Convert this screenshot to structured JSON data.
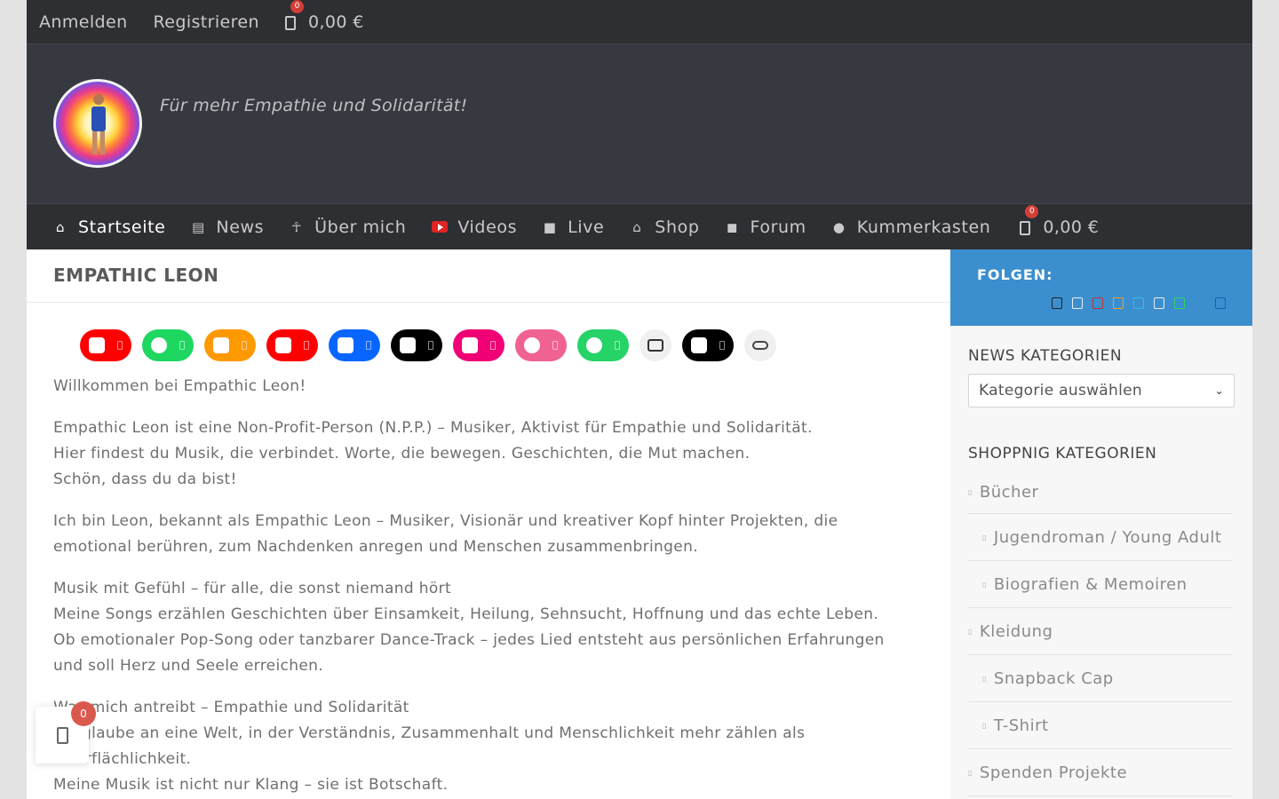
{
  "topbar": {
    "login": "Anmelden",
    "register": "Registrieren",
    "cart_count": "0",
    "cart_total": "0,00 €"
  },
  "header": {
    "tagline": "Für mehr Empathie und Solidarität!"
  },
  "nav": {
    "items": [
      {
        "label": "Startseite",
        "icon": "home-icon",
        "active": true
      },
      {
        "label": "News",
        "icon": "newspaper-icon"
      },
      {
        "label": "Über mich",
        "icon": "person-icon"
      },
      {
        "label": "Videos",
        "icon": "youtube-icon"
      },
      {
        "label": "Live",
        "icon": "video-camera-icon"
      },
      {
        "label": "Shop",
        "icon": "store-icon"
      },
      {
        "label": "Forum",
        "icon": "comments-icon"
      },
      {
        "label": "Kummerkasten",
        "icon": "speech-bubble-icon"
      }
    ],
    "cart_count": "0",
    "cart_total": "0,00 €"
  },
  "main": {
    "title": "EMPATHIC LEON",
    "social": [
      {
        "name": "youtube",
        "color": "#ff0000"
      },
      {
        "name": "spotify",
        "color": "#1ed760"
      },
      {
        "name": "amazon",
        "color": "#f90"
      },
      {
        "name": "youtube",
        "color": "#ff0000"
      },
      {
        "name": "facebook",
        "color": "#0866ff"
      },
      {
        "name": "tiktok",
        "color": "#000000"
      },
      {
        "name": "instagram",
        "color": "#f00075"
      },
      {
        "name": "dribbble",
        "color": "#f06292"
      },
      {
        "name": "whatsapp",
        "color": "#25d366"
      },
      {
        "name": "mail",
        "color": "#f0f0f0"
      },
      {
        "name": "threads",
        "color": "#000000"
      },
      {
        "name": "link",
        "color": "#f0f0f0"
      }
    ],
    "intro": "Willkommen bei Empathic Leon!",
    "p1": [
      "Empathic Leon ist eine Non-Profit-Person (N.P.P.) – Musiker, Aktivist für Empathie und Solidarität.",
      "Hier findest du Musik, die verbindet. Worte, die bewegen. Geschichten, die Mut machen.",
      "Schön, dass du da bist!"
    ],
    "p2": [
      "Ich bin Leon, bekannt als Empathic Leon – Musiker, Visionär und kreativer Kopf hinter Projekten, die",
      "emotional berühren, zum Nachdenken anregen und Menschen zusammenbringen."
    ],
    "p3": [
      "Musik mit Gefühl – für alle, die sonst niemand hört",
      "Meine Songs erzählen Geschichten über Einsamkeit, Heilung, Sehnsucht, Hoffnung und das echte Leben.",
      "Ob emotionaler Pop-Song oder tanzbarer Dance-Track – jedes Lied entsteht aus persönlichen Erfahrungen",
      "und soll Herz und Seele erreichen."
    ],
    "p4": [
      "Was mich antreibt – Empathie und Solidarität",
      "Ich glaube an eine Welt, in der Verständnis, Zusammenhalt und Menschlichkeit mehr zählen als",
      "Oberflächlichkeit.",
      "Meine Musik ist nicht nur Klang – sie ist Botschaft."
    ],
    "glyph": ""
  },
  "sidebar": {
    "follow_title": "FOLGEN:",
    "follow_icons": [
      {
        "icon": "x-icon",
        "color": "#222222"
      },
      {
        "icon": "facebook-icon",
        "color": "#eeeeee"
      },
      {
        "icon": "youtube-icon",
        "color": "#c4302b"
      },
      {
        "icon": "amazon-icon",
        "color": "#f0a020"
      },
      {
        "icon": "vimeo-icon",
        "color": "#3eb5e8"
      },
      {
        "icon": "spotify-icon",
        "color": "#eeeeee"
      },
      {
        "icon": "whatsapp-icon",
        "color": "#2ed36f"
      },
      {
        "icon": "instagram-icon",
        "color": "#3b8fcf"
      },
      {
        "icon": "linkedin-icon",
        "color": "#1a5fa8"
      }
    ],
    "news_title": "NEWS KATEGORIEN",
    "news_select": "Kategorie auswählen",
    "shop_title": "SHOPPNIG KATEGORIEN",
    "categories": [
      {
        "label": "Bücher",
        "sub": false
      },
      {
        "label": "Jugendroman / Young Adult",
        "sub": true
      },
      {
        "label": "Biografien & Memoiren",
        "sub": true
      },
      {
        "label": "Kleidung",
        "sub": false
      },
      {
        "label": "Snapback Cap",
        "sub": true
      },
      {
        "label": "T-Shirt",
        "sub": true
      },
      {
        "label": "Spenden Projekte",
        "sub": false
      }
    ]
  },
  "float_cart": {
    "count": "0"
  }
}
